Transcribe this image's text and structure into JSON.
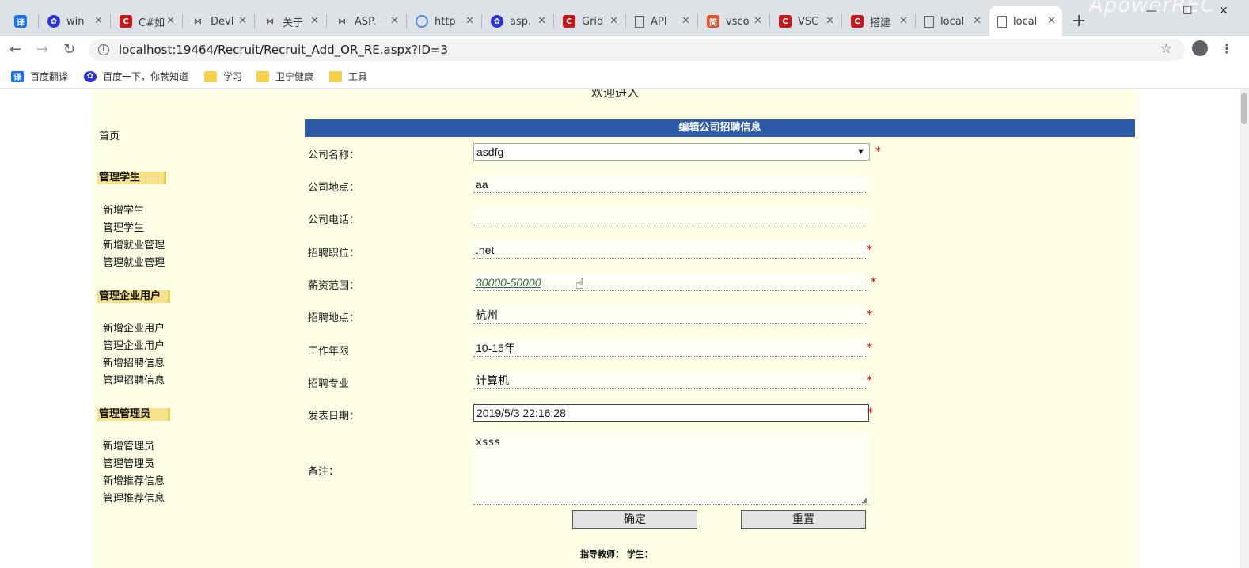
{
  "browser": {
    "tabs": [
      {
        "label": "win",
        "icon": "baidu-icon"
      },
      {
        "label": "C#如",
        "icon": "csdn-icon"
      },
      {
        "label": "Devl",
        "icon": "visual-studio-icon"
      },
      {
        "label": "关于",
        "icon": "visual-studio-icon"
      },
      {
        "label": "ASP.",
        "icon": "visual-studio-icon"
      },
      {
        "label": "http",
        "icon": "web-icon"
      },
      {
        "label": "asp.",
        "icon": "baidu-icon"
      },
      {
        "label": "Grid",
        "icon": "csdn-icon"
      },
      {
        "label": "API",
        "icon": "document-icon"
      },
      {
        "label": "vsco",
        "icon": "jianshu-icon"
      },
      {
        "label": "VSC",
        "icon": "csdn-icon"
      },
      {
        "label": "搭建",
        "icon": "csdn-icon"
      },
      {
        "label": "local",
        "icon": "document-icon"
      },
      {
        "label": "local",
        "icon": "document-icon"
      }
    ],
    "url": "localhost:19464/Recruit/Recruit_Add_OR_RE.aspx?ID=3",
    "bookmarks": [
      {
        "label": "百度翻译",
        "icon": "translate-icon"
      },
      {
        "label": "百度一下，你就知道",
        "icon": "baidu-icon"
      },
      {
        "label": "学习",
        "icon": "folder-icon"
      },
      {
        "label": "卫宁健康",
        "icon": "folder-icon"
      },
      {
        "label": "工具",
        "icon": "folder-icon"
      }
    ]
  },
  "page": {
    "welcome": "欢迎进入",
    "sidebar": {
      "home": "首页",
      "groups": [
        {
          "title": "管理学生",
          "items": [
            "新增学生",
            "管理学生",
            "新增就业管理",
            "管理就业管理"
          ]
        },
        {
          "title": "管理企业用户",
          "items": [
            "新增企业用户",
            "管理企业用户",
            "新增招聘信息",
            "管理招聘信息"
          ]
        },
        {
          "title": "管理管理员",
          "items": [
            "新增管理员",
            "管理管理员",
            "新增推荐信息",
            "管理推荐信息"
          ]
        }
      ]
    },
    "form": {
      "header": "编辑公司招聘信息",
      "required_mark": "*",
      "company_name": {
        "label": "公司名称：",
        "value": "asdfg"
      },
      "company_address": {
        "label": "公司地点：",
        "value": "aa"
      },
      "company_phone": {
        "label": "公司电话：",
        "value": ""
      },
      "position": {
        "label": "招聘职位：",
        "value": ".net"
      },
      "salary": {
        "label": "薪资范围：",
        "value": "30000-50000"
      },
      "location": {
        "label": "招聘地点：",
        "value": "杭州"
      },
      "experience": {
        "label": "工作年限",
        "value": "10-15年"
      },
      "major": {
        "label": "招聘专业",
        "value": "计算机"
      },
      "publish_date": {
        "label": "发表日期：",
        "value": "2019/5/3 22:16:28"
      },
      "remark": {
        "label": "备注：",
        "value": "xsss"
      },
      "confirm_button": "确定",
      "reset_button": "重置"
    },
    "footer": "指导教师：  学生："
  }
}
